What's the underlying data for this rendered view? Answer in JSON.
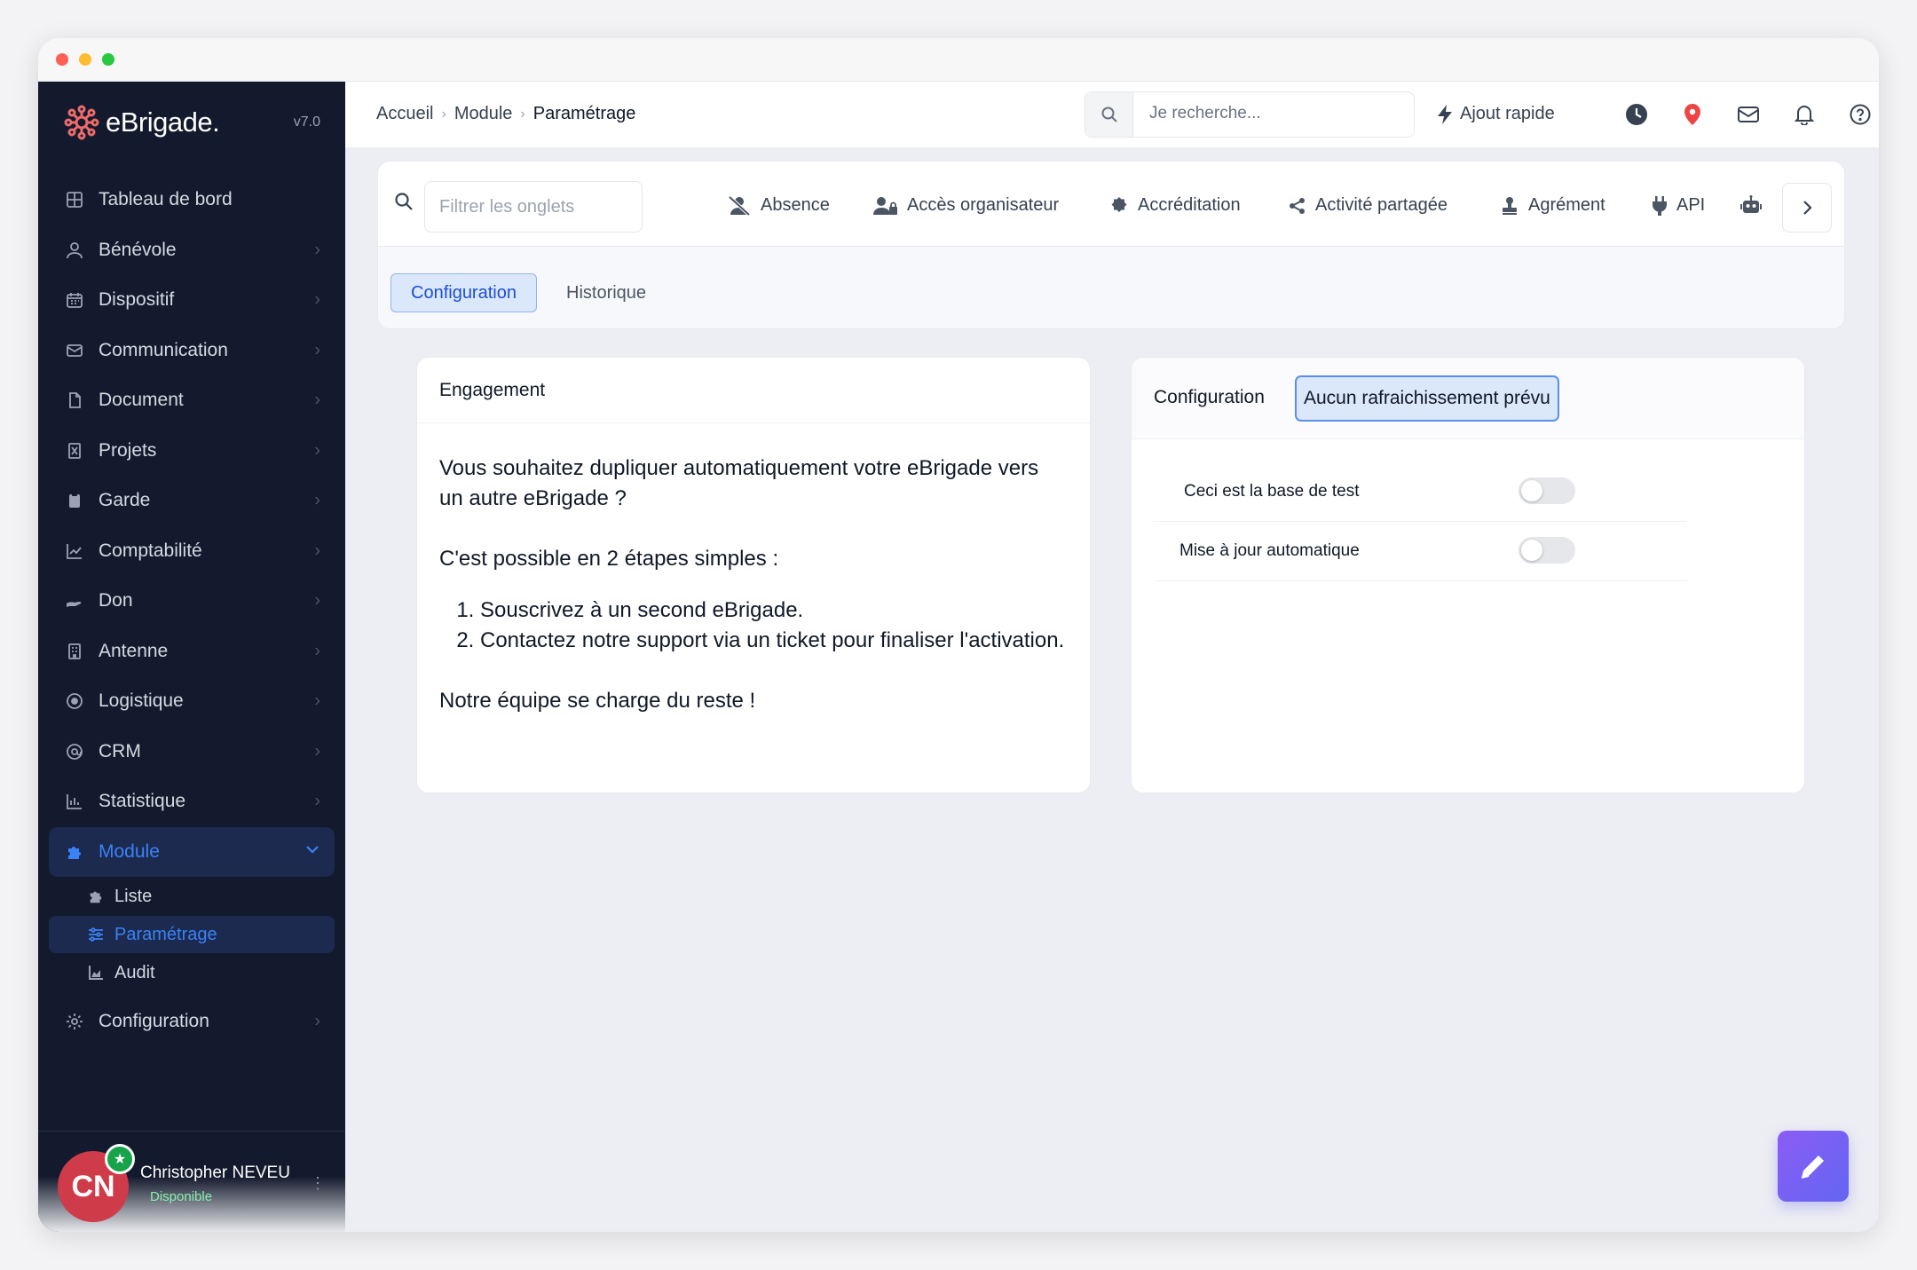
{
  "app": {
    "name": "eBrigade.",
    "version": "v7.0"
  },
  "sidebar": {
    "items": [
      {
        "label": "Tableau de bord",
        "icon": "dashboard-icon"
      },
      {
        "label": "Bénévole",
        "icon": "user-icon"
      },
      {
        "label": "Dispositif",
        "icon": "calendar-icon"
      },
      {
        "label": "Communication",
        "icon": "mail-icon"
      },
      {
        "label": "Document",
        "icon": "document-icon"
      },
      {
        "label": "Projets",
        "icon": "project-icon"
      },
      {
        "label": "Garde",
        "icon": "clipboard-icon"
      },
      {
        "label": "Comptabilité",
        "icon": "chart-line-icon"
      },
      {
        "label": "Don",
        "icon": "hand-icon"
      },
      {
        "label": "Antenne",
        "icon": "building-icon"
      },
      {
        "label": "Logistique",
        "icon": "target-icon"
      },
      {
        "label": "CRM",
        "icon": "at-icon"
      },
      {
        "label": "Statistique",
        "icon": "bar-chart-icon"
      },
      {
        "label": "Module",
        "icon": "puzzle-icon",
        "active": true
      }
    ],
    "sub_items": [
      {
        "label": "Liste",
        "icon": "puzzle-icon"
      },
      {
        "label": "Paramétrage",
        "icon": "sliders-icon",
        "active": true
      },
      {
        "label": "Audit",
        "icon": "area-chart-icon"
      }
    ],
    "footer_item": {
      "label": "Configuration",
      "icon": "gear-icon"
    },
    "user": {
      "initials": "CN",
      "name": "Christopher NEVEU",
      "status": "Disponible"
    }
  },
  "header": {
    "breadcrumb": [
      "Accueil",
      "Module",
      "Paramétrage"
    ],
    "search_placeholder": "Je recherche...",
    "quick_add_label": "Ajout rapide",
    "icons": [
      "clock-icon",
      "location-pin-icon",
      "mail-icon",
      "bell-icon",
      "help-icon"
    ]
  },
  "tabs": {
    "filter_placeholder": "Filtrer les onglets",
    "items": [
      {
        "label": "Absence",
        "icon": "user-slash-icon"
      },
      {
        "label": "Accès organisateur",
        "icon": "user-lock-icon"
      },
      {
        "label": "Accréditation",
        "icon": "badge-icon"
      },
      {
        "label": "Activité partagée",
        "icon": "share-icon"
      },
      {
        "label": "Agrément",
        "icon": "stamp-icon"
      },
      {
        "label": "API",
        "icon": "plug-icon"
      }
    ],
    "sub_tabs": [
      "Configuration",
      "Historique"
    ]
  },
  "engagement": {
    "title": "Engagement",
    "intro": "Vous souhaitez dupliquer automatiquement votre eBrigade vers un autre eBrigade ?",
    "steps_intro": "C'est possible en 2 étapes simples :",
    "steps": [
      "Souscrivez à un second eBrigade.",
      "Contactez notre support via un ticket pour finaliser l'activation."
    ],
    "outro": "Notre équipe se charge du reste !"
  },
  "configuration": {
    "title": "Configuration",
    "refresh_badge": "Aucun rafraichissement prévu",
    "options": [
      {
        "label": "Ceci est la base de test",
        "enabled": false
      },
      {
        "label": "Mise à jour automatique",
        "enabled": false
      }
    ]
  },
  "colors": {
    "sidebar_bg": "#131a2d",
    "accent": "#3b82f6",
    "fab": "#7c6cf0"
  }
}
